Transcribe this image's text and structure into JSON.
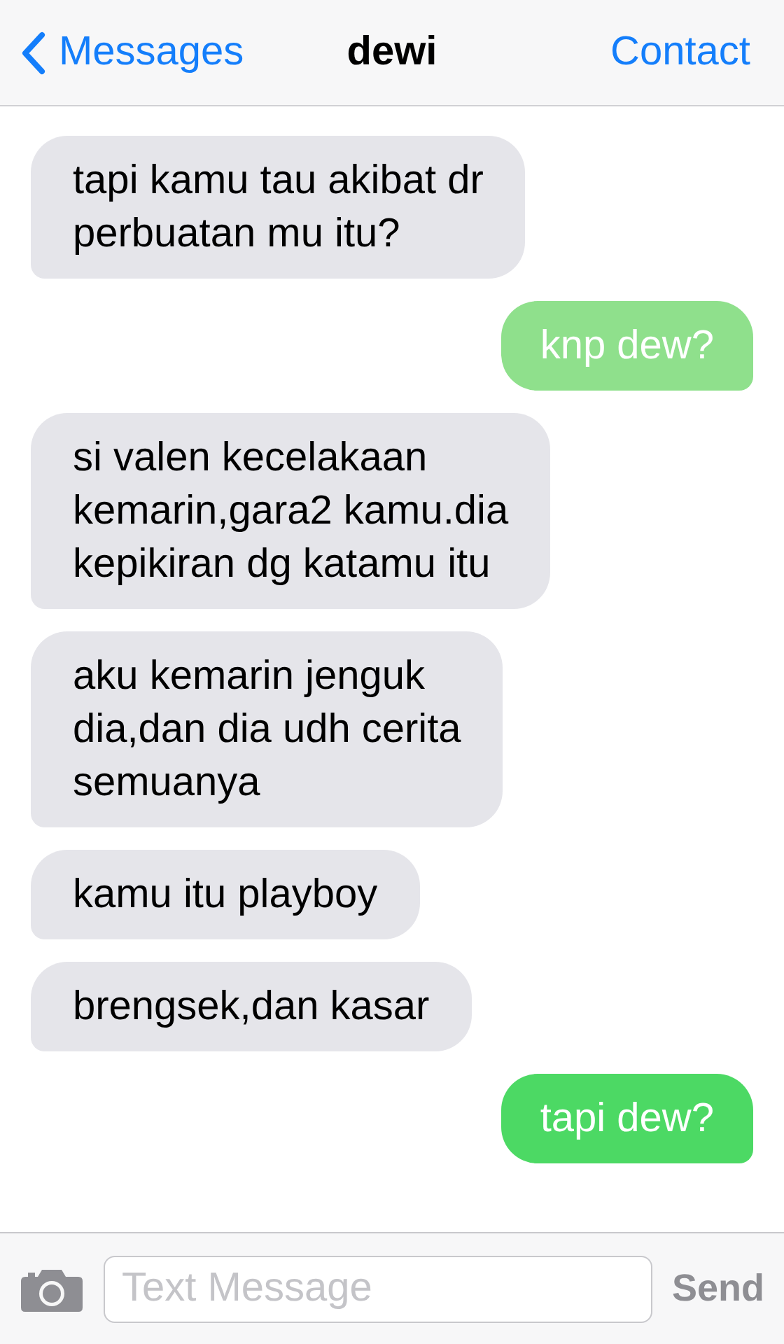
{
  "nav_bar": {
    "back": "Messages",
    "title": "dewi",
    "action": "Contact"
  },
  "messages": [
    {
      "kind": "incoming",
      "text": "tapi kamu tau akibat dr\nperbuatan mu itu?",
      "color": "#e5e5ea"
    },
    {
      "kind": "outgoing",
      "text": "knp dew?",
      "color": "#8fe08c"
    },
    {
      "kind": "incoming",
      "text": "si valen kecelakaan\nkemarin,gara2 kamu.dia\nkepikiran dg katamu itu",
      "color": "#e5e5ea"
    },
    {
      "kind": "incoming",
      "text": "aku kemarin jenguk\ndia,dan dia udh cerita\nsemuanya",
      "color": "#e5e5ea"
    },
    {
      "kind": "incoming",
      "text": "kamu itu playboy",
      "color": "#e5e5ea"
    },
    {
      "kind": "incoming",
      "text": "brengsek,dan kasar",
      "color": "#e5e5ea"
    },
    {
      "kind": "outgoing",
      "text": "tapi dew?",
      "color": "#4cd964"
    }
  ],
  "input_bar": {
    "placeholder": "Text Message",
    "send": "Send",
    "send_disabled": true
  }
}
